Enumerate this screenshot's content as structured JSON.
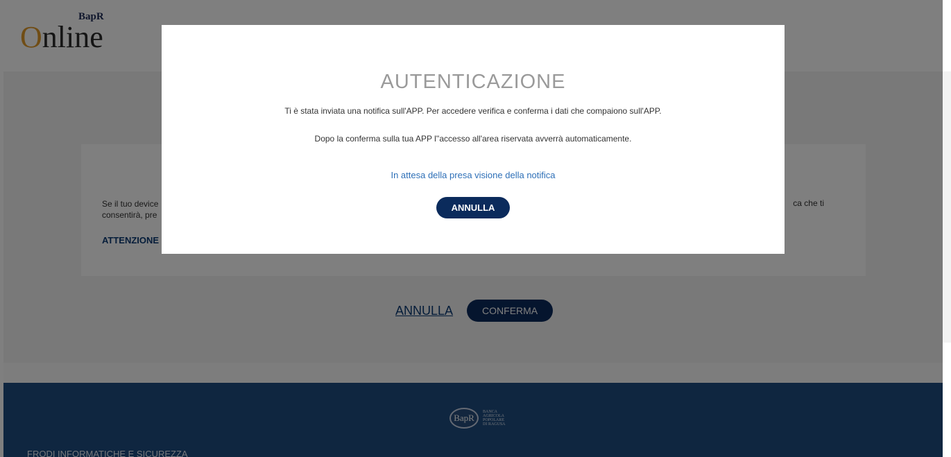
{
  "header": {
    "logo_main": "Online",
    "logo_sup": "BapR"
  },
  "card": {
    "text_left_line1": "Se il tuo device",
    "text_left_line2": "consentirà, pre",
    "text_right": "ca che ti",
    "warning": "ATTENZIONE"
  },
  "actions": {
    "annulla_label": "ANNULLA",
    "conferma_label": "CONFERMA"
  },
  "modal": {
    "title": "AUTENTICAZIONE",
    "paragraph1": "Ti è stata inviata una notifica sull'APP. Per accedere verifica e conferma i dati che compaiono sull'APP.",
    "paragraph2": "Dopo la conferma sulla tua APP l''accesso all'area riservata avverrà automaticamente.",
    "status": "In attesa della presa visione della notifica",
    "button_label": "ANNULLA"
  },
  "footer": {
    "seal_letters": "BapR",
    "bank_name_lines": [
      "BANCA",
      "AGRICOLA",
      "POPOLARE",
      "DI RAGUSA"
    ],
    "link": "FRODI INFORMATICHE E SICUREZZA"
  },
  "colors": {
    "brand_navy": "#0b2b5c",
    "footer_blue": "#1f4d80",
    "link_blue": "#2d6fb7"
  }
}
